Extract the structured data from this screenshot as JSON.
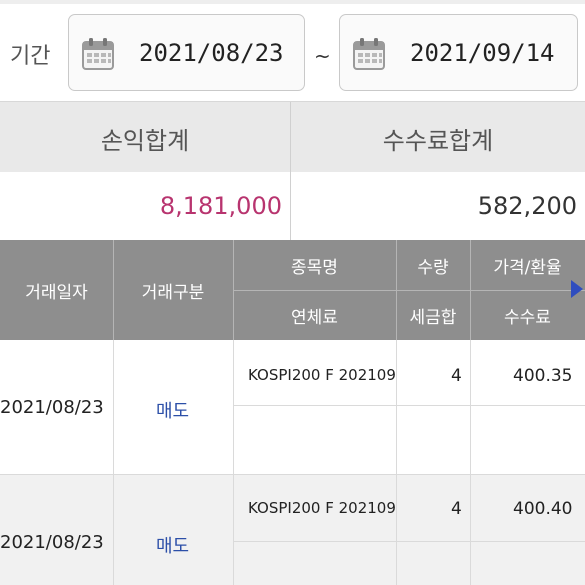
{
  "period": {
    "label": "기간",
    "from_date": "2021/08/23",
    "separator": "~",
    "to_date": "2021/09/14"
  },
  "summary": {
    "profit_label": "손익합계",
    "profit_value": "8,181,000",
    "fee_label": "수수료합계",
    "fee_value": "582,200",
    "profit_color": "#b8346f"
  },
  "table": {
    "headers": {
      "trade_date": "거래일자",
      "trade_type": "거래구분",
      "item_name": "종목명",
      "quantity": "수량",
      "price": "가격/환율",
      "late_fee": "연체료",
      "tax_total": "세금합",
      "commission": "수수료"
    },
    "rows": [
      {
        "trade_date": "2021/08/23",
        "trade_type": "매도",
        "item_name": "KOSPI200 F 202109",
        "quantity": "4",
        "price": "400.35"
      },
      {
        "trade_date": "2021/08/23",
        "trade_type": "매도",
        "item_name": "KOSPI200 F 202109",
        "quantity": "4",
        "price": "400.40"
      }
    ]
  },
  "icons": {
    "calendar": "calendar-icon",
    "scroll_right": "arrow-right-icon"
  },
  "colors": {
    "header_bg": "#8e8e8e",
    "trade_type": "#2c4fa8",
    "arrow": "#2f4dbf"
  }
}
